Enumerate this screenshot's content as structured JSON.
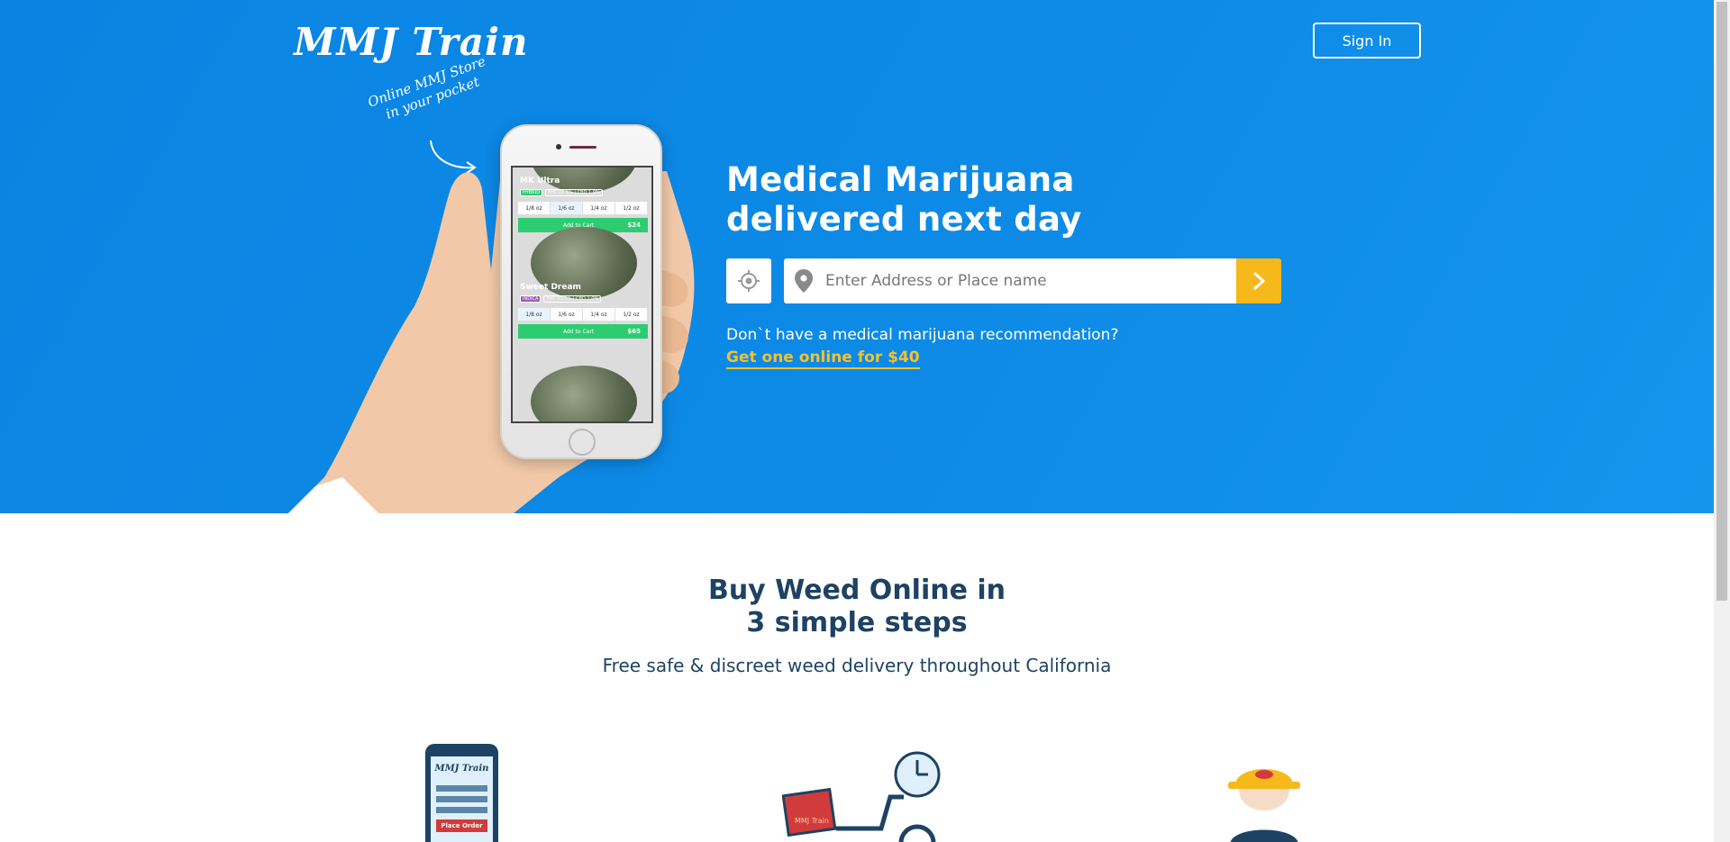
{
  "header": {
    "logo_text": "MMJ Train",
    "sign_in_label": "Sign In"
  },
  "hero": {
    "tagline_line1": "Online MMJ Store",
    "tagline_line2": "in your pocket",
    "headline_line1": "Medical Marijuana",
    "headline_line2": "delivered next day",
    "address_placeholder": "Enter Address or Place name",
    "recommendation_question": "Don`t have a medical marijuana recommendation?",
    "recommendation_link": "Get one online for $40"
  },
  "phone_screen": {
    "products": [
      {
        "name": "MK Ultra",
        "type": "HYBRID",
        "info": "THC 21.5% | CBD 1.0%",
        "sizes": [
          "1/8 oz",
          "1/6 oz",
          "1/4 oz",
          "1/2 oz"
        ],
        "selected_size": "1/6 oz",
        "cart_label": "Add to Cart",
        "price": "$24"
      },
      {
        "name": "Sweet Dream",
        "type": "INDICA",
        "info": "THC 21.5% | CBD 1.0%",
        "sizes": [
          "1/8 oz",
          "1/6 oz",
          "1/4 oz",
          "1/2 oz"
        ],
        "selected_size": "1/8 oz",
        "cart_label": "Add to Cart",
        "price": "$65"
      }
    ]
  },
  "steps": {
    "title_line1": "Buy Weed Online in",
    "title_line2": "3 simple steps",
    "subtitle": "Free safe & discreet weed delivery throughout California",
    "step1_brand": "MMJ Train",
    "step1_button": "Place Order",
    "step2_label": "MMJ Train"
  },
  "colors": {
    "hero_blue": "#0a84e2",
    "accent_yellow": "#f6b91c",
    "link_yellow": "#f6c12b",
    "navy": "#1e4263",
    "green": "#2ecc71"
  }
}
